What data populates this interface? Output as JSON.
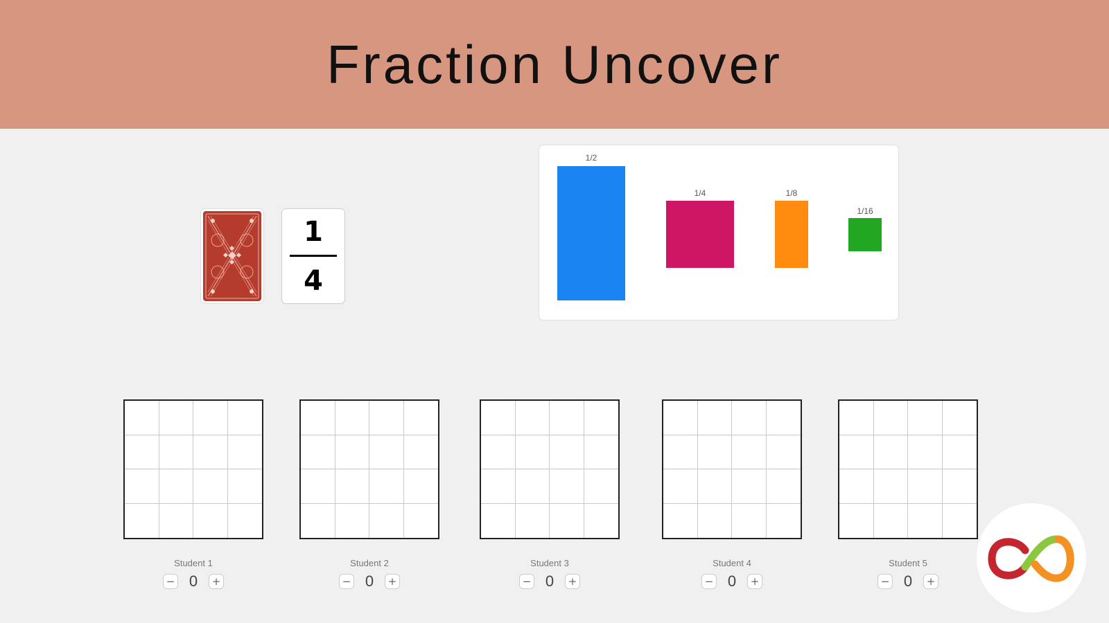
{
  "header": {
    "title": "Fraction Uncover"
  },
  "drawn_card": {
    "numerator": "1",
    "denominator": "4"
  },
  "fraction_pieces": [
    {
      "label": "1/2",
      "value": 0.5,
      "color": "#1a84f0"
    },
    {
      "label": "1/4",
      "value": 0.25,
      "color": "#cf1664"
    },
    {
      "label": "1/8",
      "value": 0.125,
      "color": "#ff8b0e"
    },
    {
      "label": "1/16",
      "value": 0.0625,
      "color": "#22a722"
    }
  ],
  "students": [
    {
      "label": "Student 1",
      "score": "0",
      "minus": "−",
      "plus": "+"
    },
    {
      "label": "Student 2",
      "score": "0",
      "minus": "−",
      "plus": "+"
    },
    {
      "label": "Student 3",
      "score": "0",
      "minus": "−",
      "plus": "+"
    },
    {
      "label": "Student 4",
      "score": "0",
      "minus": "−",
      "plus": "+"
    },
    {
      "label": "Student 5",
      "score": "0",
      "minus": "−",
      "plus": "+"
    }
  ],
  "board": {
    "rows": 4,
    "cols": 4
  },
  "logo": {
    "colors": [
      "#c3262f",
      "#8dc63f",
      "#f39223"
    ]
  }
}
